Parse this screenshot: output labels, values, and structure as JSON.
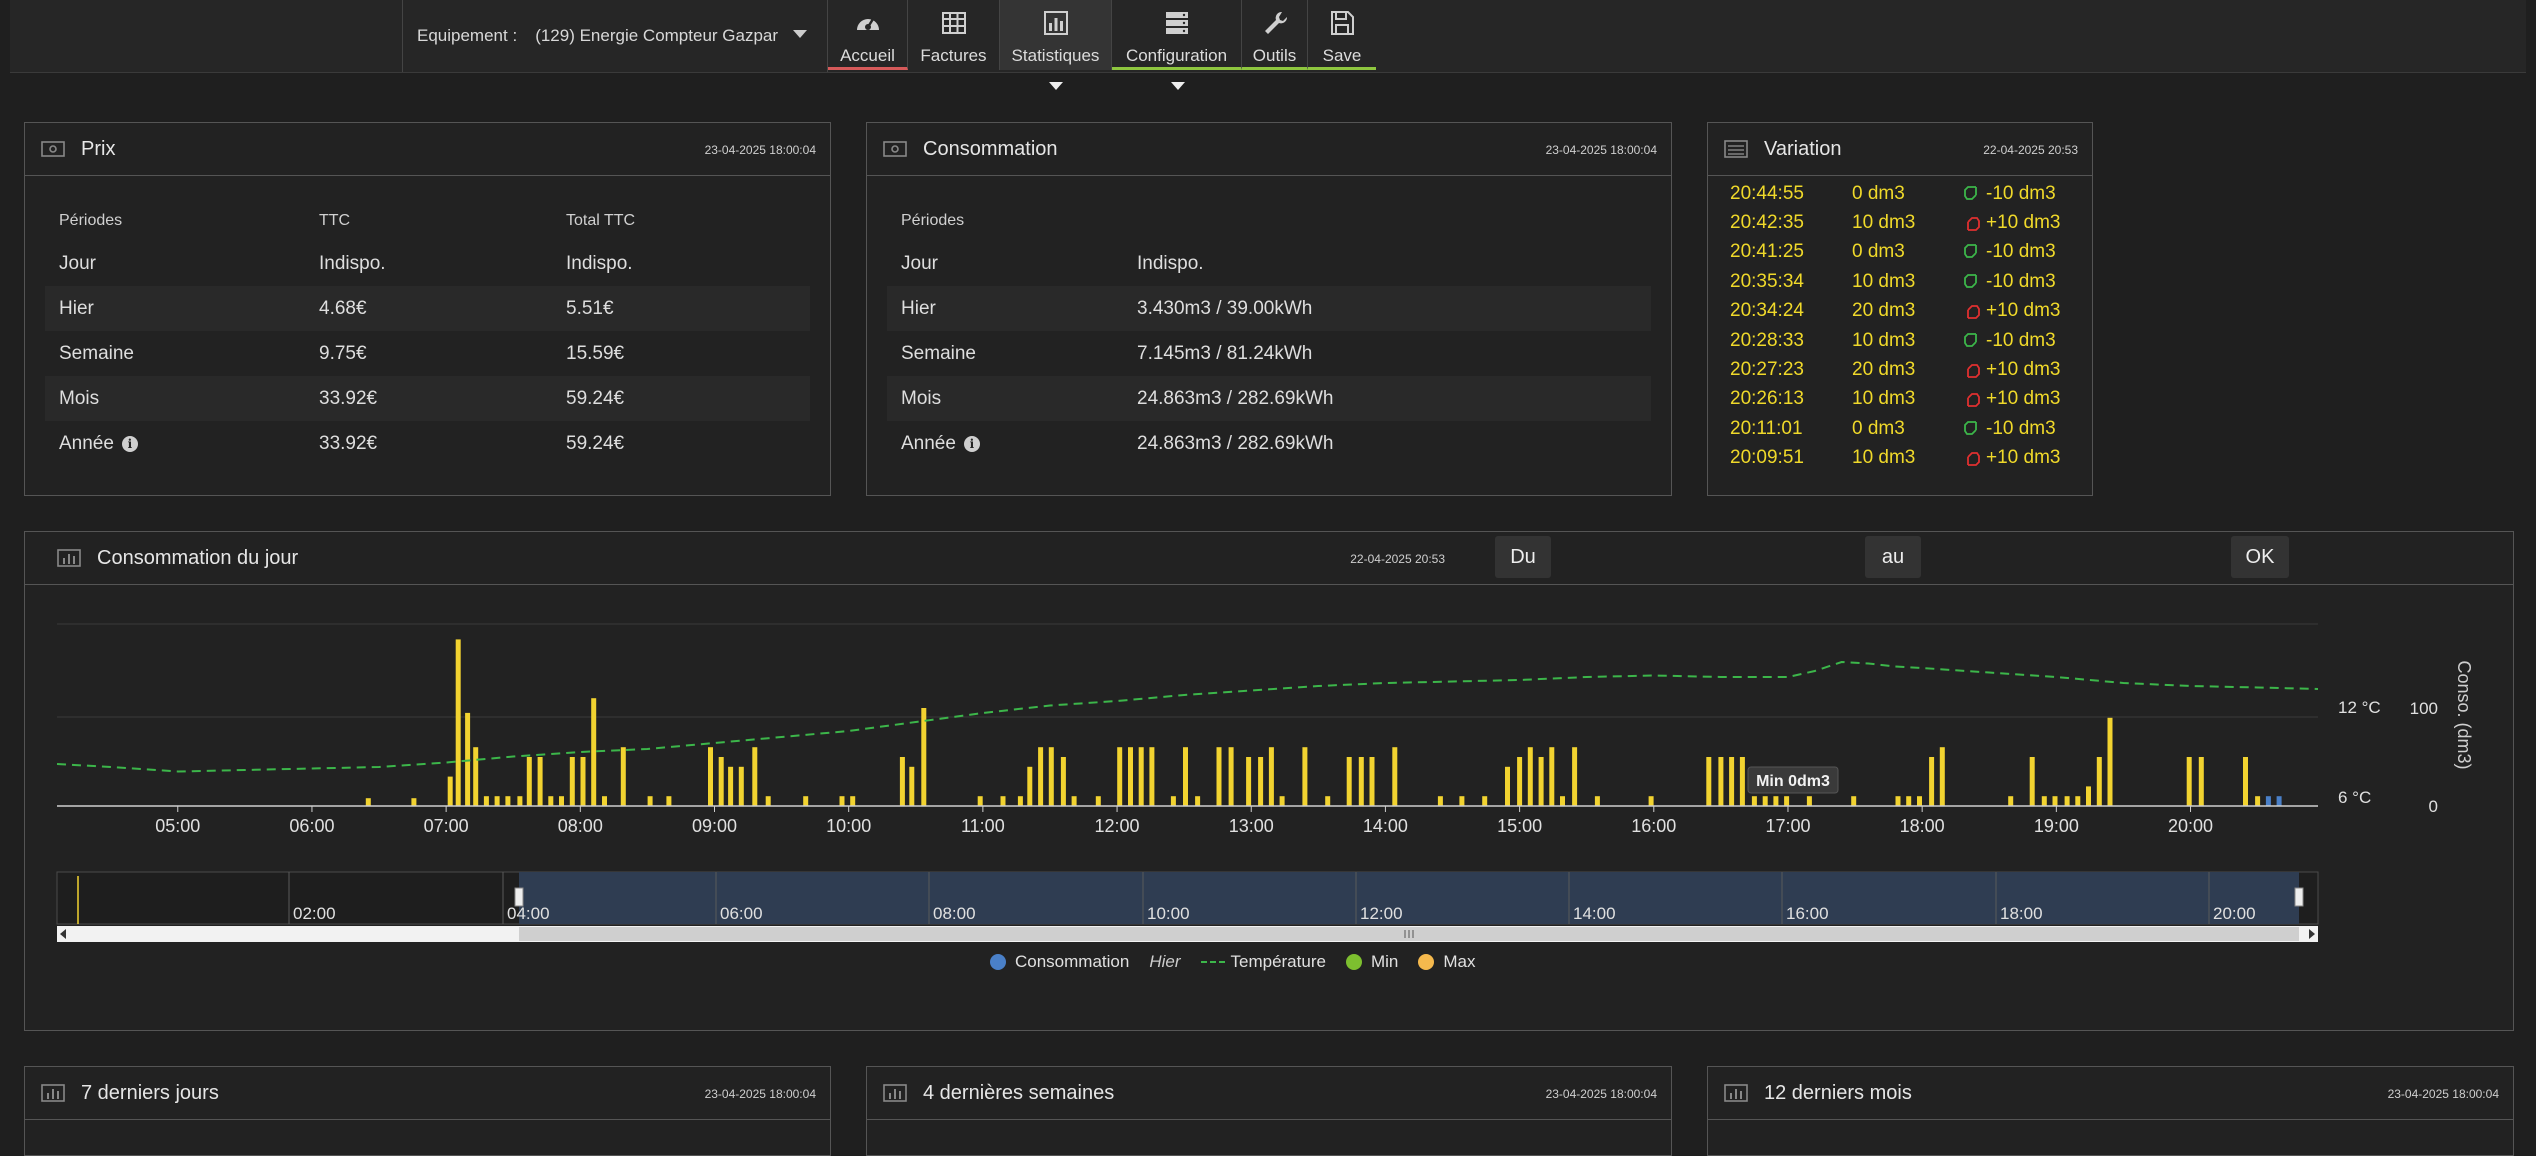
{
  "header": {
    "equipement_label": "Equipement :",
    "equipement_value": "(129) Energie Compteur Gazpar",
    "nav": [
      {
        "label": "Accueil",
        "icon": "gauge-icon"
      },
      {
        "label": "Factures",
        "icon": "table-icon"
      },
      {
        "label": "Statistiques",
        "icon": "bar-chart-icon"
      },
      {
        "label": "Configuration",
        "icon": "server-icon"
      },
      {
        "label": "Outils",
        "icon": "wrench-icon"
      },
      {
        "label": "Save",
        "icon": "floppy-icon"
      }
    ]
  },
  "prix": {
    "title": "Prix",
    "date": "23-04-2025 18:00:04",
    "columns": [
      "Périodes",
      "TTC",
      "Total TTC"
    ],
    "rows": [
      {
        "period": "Jour",
        "ttc": "Indispo.",
        "total": "Indispo."
      },
      {
        "period": "Hier",
        "ttc": "4.68€",
        "total": "5.51€"
      },
      {
        "period": "Semaine",
        "ttc": "9.75€",
        "total": "15.59€"
      },
      {
        "period": "Mois",
        "ttc": "33.92€",
        "total": "59.24€"
      },
      {
        "period": "Année",
        "ttc": "33.92€",
        "total": "59.24€"
      }
    ]
  },
  "consommation": {
    "title": "Consommation",
    "date": "23-04-2025 18:00:04",
    "columns": [
      "Périodes"
    ],
    "rows": [
      {
        "period": "Jour",
        "value": "Indispo."
      },
      {
        "period": "Hier",
        "value": "3.430m3 / 39.00kWh"
      },
      {
        "period": "Semaine",
        "value": "7.145m3 / 81.24kWh"
      },
      {
        "period": "Mois",
        "value": "24.863m3 / 282.69kWh"
      },
      {
        "period": "Année",
        "value": "24.863m3 / 282.69kWh"
      }
    ]
  },
  "variation": {
    "title": "Variation",
    "date": "22-04-2025 20:53",
    "rows": [
      {
        "time": "20:44:55",
        "value": "0 dm3",
        "delta": "-10 dm3",
        "dir": "down"
      },
      {
        "time": "20:42:35",
        "value": "10 dm3",
        "delta": "+10 dm3",
        "dir": "up"
      },
      {
        "time": "20:41:25",
        "value": "0 dm3",
        "delta": "-10 dm3",
        "dir": "down"
      },
      {
        "time": "20:35:34",
        "value": "10 dm3",
        "delta": "-10 dm3",
        "dir": "down"
      },
      {
        "time": "20:34:24",
        "value": "20 dm3",
        "delta": "+10 dm3",
        "dir": "up"
      },
      {
        "time": "20:28:33",
        "value": "10 dm3",
        "delta": "-10 dm3",
        "dir": "down"
      },
      {
        "time": "20:27:23",
        "value": "20 dm3",
        "delta": "+10 dm3",
        "dir": "up"
      },
      {
        "time": "20:26:13",
        "value": "10 dm3",
        "delta": "+10 dm3",
        "dir": "up"
      },
      {
        "time": "20:11:01",
        "value": "0 dm3",
        "delta": "-10 dm3",
        "dir": "down"
      },
      {
        "time": "20:09:51",
        "value": "10 dm3",
        "delta": "+10 dm3",
        "dir": "up"
      }
    ],
    "colors": {
      "text": "#f0d92a",
      "down": "#3cb64a",
      "up": "#e03030"
    }
  },
  "jour": {
    "title": "Consommation du jour",
    "date": "22-04-2025 20:53",
    "du_label": "Du",
    "au_label": "au",
    "ok_label": "OK",
    "tooltip": "Min 0dm3",
    "right_axis_title": "Conso. (dm3)"
  },
  "chart_data": {
    "type": "bar",
    "x_ticks": [
      "05:00",
      "06:00",
      "07:00",
      "08:00",
      "09:00",
      "10:00",
      "11:00",
      "12:00",
      "13:00",
      "14:00",
      "15:00",
      "16:00",
      "17:00",
      "18:00",
      "19:00",
      "20:00"
    ],
    "x_range_hours": [
      4.1,
      20.95
    ],
    "yaxis_temp": {
      "ticks": [
        "6 °C",
        "12 °C"
      ],
      "values": [
        6,
        12
      ]
    },
    "yaxis_conso": {
      "title": "Conso. (dm3)",
      "ticks": [
        "0",
        "100"
      ],
      "values": [
        0,
        100
      ]
    },
    "grid": true,
    "series": [
      {
        "name": "Consommation",
        "color": "#f2d330",
        "highlight_color": "#4a80c8",
        "times": [
          6.42,
          6.76,
          7.03,
          7.09,
          7.16,
          7.22,
          7.3,
          7.38,
          7.46,
          7.55,
          7.62,
          7.7,
          7.78,
          7.86,
          7.94,
          8.02,
          8.1,
          8.18,
          8.32,
          8.52,
          8.66,
          8.97,
          9.05,
          9.12,
          9.2,
          9.3,
          9.4,
          9.68,
          9.95,
          10.03,
          10.4,
          10.47,
          10.56,
          10.98,
          11.15,
          11.28,
          11.35,
          11.43,
          11.51,
          11.6,
          11.68,
          11.86,
          12.02,
          12.1,
          12.18,
          12.26,
          12.42,
          12.51,
          12.6,
          12.76,
          12.85,
          12.98,
          13.07,
          13.15,
          13.23,
          13.4,
          13.57,
          13.73,
          13.82,
          13.9,
          14.07,
          14.41,
          14.57,
          14.74,
          14.91,
          15.0,
          15.08,
          15.16,
          15.24,
          15.32,
          15.41,
          15.58,
          15.98,
          16.41,
          16.5,
          16.58,
          16.66,
          16.75,
          16.83,
          16.91,
          16.99,
          17.16,
          17.49,
          17.82,
          17.9,
          17.98,
          18.07,
          18.15,
          18.66,
          18.82,
          18.91,
          18.99,
          19.08,
          19.16,
          19.24,
          19.32,
          19.4,
          19.99,
          20.08,
          20.41,
          20.5,
          20.58,
          20.66
        ],
        "values": [
          8,
          8,
          30,
          170,
          95,
          60,
          10,
          10,
          10,
          10,
          50,
          50,
          10,
          10,
          50,
          50,
          110,
          10,
          60,
          10,
          10,
          60,
          50,
          40,
          40,
          60,
          10,
          10,
          10,
          10,
          50,
          40,
          100,
          10,
          10,
          10,
          40,
          60,
          60,
          50,
          10,
          10,
          60,
          60,
          60,
          60,
          10,
          60,
          10,
          60,
          60,
          50,
          50,
          60,
          10,
          60,
          10,
          50,
          50,
          50,
          60,
          10,
          10,
          10,
          40,
          50,
          60,
          50,
          60,
          10,
          60,
          10,
          10,
          50,
          50,
          50,
          50,
          10,
          10,
          10,
          10,
          10,
          10,
          10,
          10,
          10,
          50,
          60,
          10,
          50,
          10,
          10,
          10,
          10,
          20,
          50,
          90,
          50,
          50,
          50,
          10,
          10,
          10,
          50,
          50,
          40,
          30
        ]
      },
      {
        "name": "Hier",
        "values": []
      },
      {
        "name": "Température",
        "color": "#3cb64a",
        "times": [
          4.1,
          4.5,
          5.0,
          5.5,
          6.0,
          6.5,
          7.0,
          7.5,
          8.0,
          8.5,
          9.0,
          9.5,
          10.0,
          10.5,
          11.0,
          11.5,
          12.0,
          12.5,
          13.0,
          13.5,
          14.0,
          14.5,
          15.0,
          15.5,
          16.0,
          16.5,
          17.0,
          17.2,
          17.4,
          17.6,
          17.8,
          18.0,
          18.5,
          19.0,
          19.5,
          20.0,
          20.5,
          20.95
        ],
        "values": [
          8.2,
          8.0,
          7.7,
          7.8,
          7.9,
          8.0,
          8.3,
          8.7,
          9.0,
          9.2,
          9.6,
          10.0,
          10.4,
          11.0,
          11.6,
          12.1,
          12.4,
          12.8,
          13.1,
          13.4,
          13.6,
          13.7,
          13.8,
          14.0,
          14.1,
          14.0,
          14.0,
          14.4,
          15.0,
          14.9,
          14.7,
          14.6,
          14.3,
          14.0,
          13.6,
          13.4,
          13.3,
          13.2
        ]
      },
      {
        "name": "Min",
        "color": "#7dbf2f",
        "values": []
      },
      {
        "name": "Max",
        "color": "#f5b94d",
        "values": []
      }
    ],
    "navigator_ticks": [
      "02:00",
      "04:00",
      "06:00",
      "08:00",
      "10:00",
      "12:00",
      "14:00",
      "16:00",
      "18:00",
      "20:00"
    ],
    "legend_position": "bottom"
  },
  "bottom_panels": [
    {
      "title": "7 derniers jours",
      "date": "23-04-2025 18:00:04"
    },
    {
      "title": "4 dernières semaines",
      "date": "23-04-2025 18:00:04"
    },
    {
      "title": "12 derniers mois",
      "date": "23-04-2025 18:00:04"
    }
  ]
}
